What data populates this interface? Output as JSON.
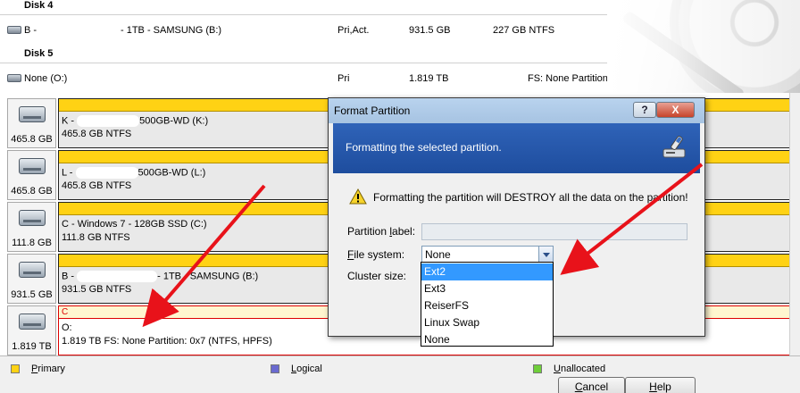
{
  "list": {
    "disk4_header": "Disk 4",
    "disk4_row": {
      "name": "B -",
      "label": "- 1TB - SAMSUNG (B:)",
      "type": "Pri,Act.",
      "size": "931.5 GB",
      "extra": "227 GB NTFS"
    },
    "disk5_header": "Disk 5",
    "disk5_row": {
      "name": "None (O:)",
      "type": "Pri",
      "size": "1.819 TB",
      "extra": "FS: None Partition: 0x7 (NTFS, HPFS)"
    }
  },
  "disks": [
    {
      "size": "465.8 GB",
      "line1_a": "K -",
      "line1_b": "500GB-WD (K:)",
      "line2": "465.8 GB  NTFS"
    },
    {
      "size": "465.8 GB",
      "line1_a": "L -",
      "line1_b": "500GB-WD (L:)",
      "line2": "465.8 GB  NTFS"
    },
    {
      "size": "111.8 GB",
      "line1_a": "C - Windows 7 - 128GB SSD (C:)",
      "line1_b": "",
      "line2": "111.8 GB  NTFS"
    },
    {
      "size": "931.5 GB",
      "line1_a": "B -",
      "line1_b": "- 1TB - SAMSUNG (B:)",
      "line2": "931.5 GB  NTFS"
    },
    {
      "size": "1.819 TB",
      "flag": "C",
      "line1_a": "O:",
      "line1_b": "",
      "line2": "1.819 TB  FS: None Partition: 0x7 (NTFS, HPFS)"
    }
  ],
  "legend": {
    "primary": {
      "label": "Primary",
      "color": "#ffd214"
    },
    "logical": {
      "label": "Logical",
      "color": "#6a6ad0"
    },
    "unallocated": {
      "label": "Unallocated",
      "color": "#6fce3a"
    }
  },
  "dialog": {
    "title": "Format Partition",
    "help_btn": "?",
    "close_btn": "X",
    "banner_text": "Formatting the selected partition.",
    "warning": "Formatting the partition will DESTROY all the data on the partition!",
    "partition_label_lbl": "Partition label:",
    "partition_label_value": "",
    "file_system_lbl": "File system:",
    "file_system_value": "None",
    "cluster_size_lbl": "Cluster size:",
    "options": [
      "Ext2",
      "Ext3",
      "ReiserFS",
      "Linux Swap",
      "None"
    ],
    "highlighted_option": "Ext2",
    "cancel": "Cancel",
    "help": "Help"
  },
  "colors": {
    "accent_blue": "#1e4d9e",
    "warning_red": "#e8121a"
  }
}
